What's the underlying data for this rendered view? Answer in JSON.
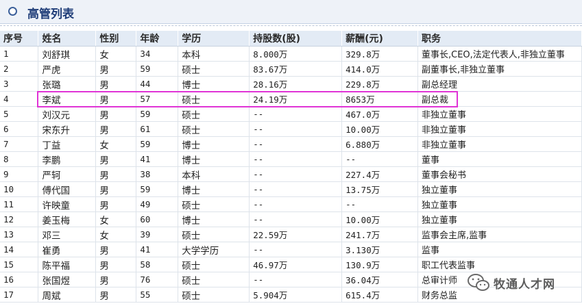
{
  "header": {
    "title": "高管列表"
  },
  "table": {
    "columns": [
      "序号",
      "姓名",
      "性别",
      "年龄",
      "学历",
      "持股数(股)",
      "薪酬(元)",
      "职务"
    ],
    "rows": [
      [
        "1",
        "刘舒琪",
        "女",
        "34",
        "本科",
        "8.000万",
        "329.8万",
        "董事长,CEO,法定代表人,非独立董事"
      ],
      [
        "2",
        "严虎",
        "男",
        "59",
        "硕士",
        "83.67万",
        "414.0万",
        "副董事长,非独立董事"
      ],
      [
        "3",
        "张璐",
        "男",
        "44",
        "博士",
        "28.16万",
        "229.8万",
        "副总经理"
      ],
      [
        "4",
        "李斌",
        "男",
        "57",
        "硕士",
        "24.19万",
        "8653万",
        "副总裁"
      ],
      [
        "5",
        "刘汉元",
        "男",
        "59",
        "硕士",
        "--",
        "467.0万",
        "非独立董事"
      ],
      [
        "6",
        "宋东升",
        "男",
        "61",
        "硕士",
        "--",
        "10.00万",
        "非独立董事"
      ],
      [
        "7",
        "丁益",
        "女",
        "59",
        "博士",
        "--",
        "6.880万",
        "非独立董事"
      ],
      [
        "8",
        "李鹏",
        "男",
        "41",
        "博士",
        "--",
        "--",
        "董事"
      ],
      [
        "9",
        "严轲",
        "男",
        "38",
        "本科",
        "--",
        "227.4万",
        "董事会秘书"
      ],
      [
        "10",
        "傅代国",
        "男",
        "59",
        "博士",
        "--",
        "13.75万",
        "独立董事"
      ],
      [
        "11",
        "许映童",
        "男",
        "49",
        "硕士",
        "--",
        "--",
        "独立董事"
      ],
      [
        "12",
        "姜玉梅",
        "女",
        "60",
        "博士",
        "--",
        "10.00万",
        "独立董事"
      ],
      [
        "13",
        "邓三",
        "女",
        "39",
        "硕士",
        "22.59万",
        "241.7万",
        "监事会主席,监事"
      ],
      [
        "14",
        "崔勇",
        "男",
        "41",
        "大学学历",
        "--",
        "3.130万",
        "监事"
      ],
      [
        "15",
        "陈平福",
        "男",
        "58",
        "硕士",
        "46.97万",
        "130.9万",
        "职工代表监事"
      ],
      [
        "16",
        "张国煜",
        "男",
        "76",
        "硕士",
        "--",
        "36.04万",
        "总审计师"
      ],
      [
        "17",
        "周斌",
        "男",
        "55",
        "硕士",
        "5.904万",
        "615.4万",
        "财务总监"
      ]
    ]
  },
  "watermark": {
    "icon": "wechat-icon",
    "text": "牧通人才网"
  },
  "colors": {
    "header_bg": "#eef2f8",
    "title": "#1f3d78",
    "highlight": "#e033d6",
    "thead_bg": "#e3ebf5"
  }
}
